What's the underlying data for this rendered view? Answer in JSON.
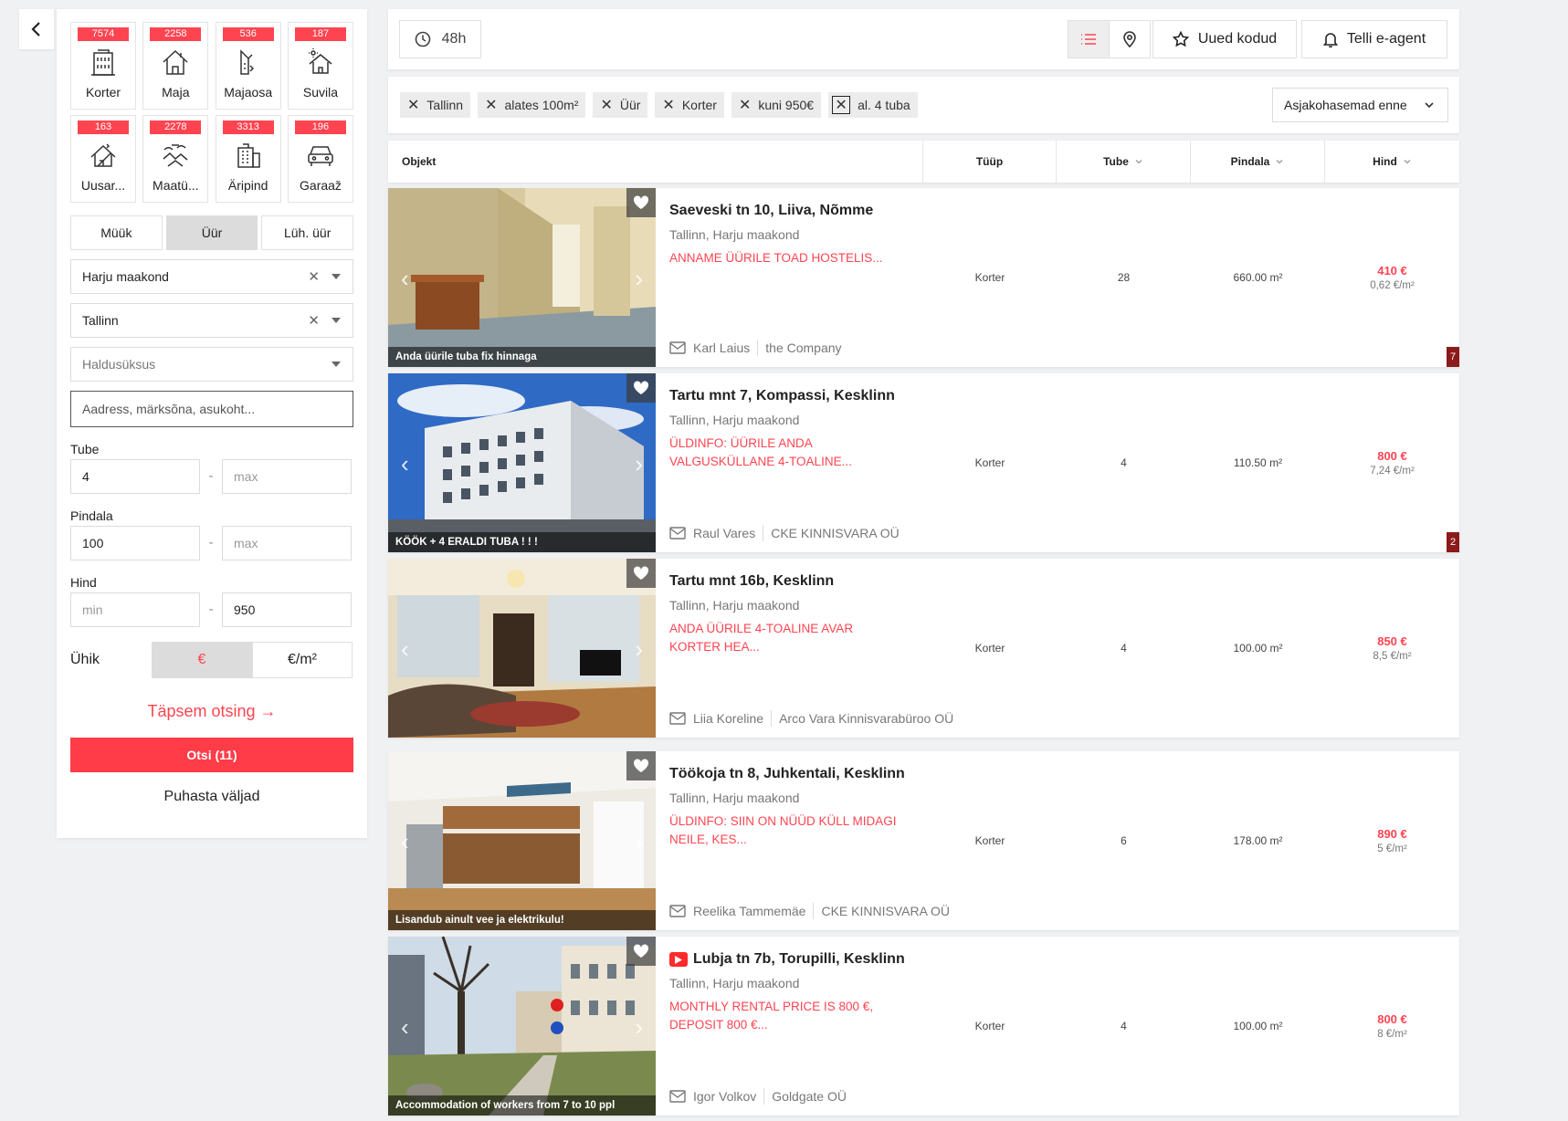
{
  "categories": [
    {
      "count": "7574",
      "label": "Korter",
      "icon": "apartment-building-icon",
      "active": true
    },
    {
      "count": "2258",
      "label": "Maja",
      "icon": "house-icon",
      "active": false
    },
    {
      "count": "536",
      "label": "Majaosa",
      "icon": "house-part-icon",
      "active": false
    },
    {
      "count": "187",
      "label": "Suvila",
      "icon": "summer-house-icon",
      "active": false
    },
    {
      "count": "163",
      "label": "Uusar...",
      "icon": "new-development-icon",
      "active": false
    },
    {
      "count": "2278",
      "label": "Maatü...",
      "icon": "land-plot-icon",
      "active": false
    },
    {
      "count": "3313",
      "label": "Äripind",
      "icon": "commercial-building-icon",
      "active": false
    },
    {
      "count": "196",
      "label": "Garaaž",
      "icon": "car-garage-icon",
      "active": false
    }
  ],
  "deal_types": {
    "sale": "Müük",
    "rent": "Üür",
    "short_rent": "Lüh. üür",
    "active": "rent"
  },
  "filters": {
    "county": "Harju maakond",
    "city": "Tallinn",
    "district_placeholder": "Haldusüksus",
    "address_placeholder": "Aadress, märksõna, asukoht...",
    "rooms_label": "Tube",
    "rooms_min": "4",
    "rooms_max_placeholder": "max",
    "area_label": "Pindala",
    "area_min": "100",
    "area_max_placeholder": "max",
    "price_label": "Hind",
    "price_min_placeholder": "min",
    "price_max": "950",
    "unit_label": "Ühik",
    "unit_eur": "€",
    "unit_eur_m2": "€/m²",
    "advanced": "Täpsem otsing →",
    "search_button": "Otsi (11)",
    "clear": "Puhasta väljad"
  },
  "topbar": {
    "recent": "48h",
    "new_homes": "Uued kodud",
    "e_agent": "Telli e-agent"
  },
  "chips": [
    "Tallinn",
    "alates 100m²",
    "Üür",
    "Korter",
    "kuni 950€",
    "al. 4 tuba"
  ],
  "sort": "Asjakohasemad enne",
  "table_headers": {
    "object": "Objekt",
    "type": "Tüüp",
    "rooms": "Tube",
    "area": "Pindala",
    "price": "Hind"
  },
  "listings": [
    {
      "title": "Saeveski tn 10, Liiva, Nõmme",
      "location": "Tallinn, Harju maakond",
      "description": "ANNAME ÜÜRILE TOAD HOSTELIS...",
      "caption": "Anda üürile tuba fix hinnaga",
      "agent": "Karl Laius",
      "company": "the Company",
      "type": "Korter",
      "rooms": "28",
      "area": "660.00 m²",
      "price": "410 €",
      "price_per_m2": "0,62 €/m²",
      "count": "7",
      "video": false
    },
    {
      "title": "Tartu mnt 7, Kompassi, Kesklinn",
      "location": "Tallinn, Harju maakond",
      "description": "ÜLDINFO: ÜÜRILE ANDA VALGUSKÜLLANE 4-TOALINE...",
      "caption": "KÖÖK + 4 ERALDI TUBA ! ! !",
      "agent": "Raul Vares",
      "company": "CKE KINNISVARA OÜ",
      "type": "Korter",
      "rooms": "4",
      "area": "110.50 m²",
      "price": "800 €",
      "price_per_m2": "7,24 €/m²",
      "count": "2",
      "video": false
    },
    {
      "title": "Tartu mnt 16b, Kesklinn",
      "location": "Tallinn, Harju maakond",
      "description": "ANDA ÜÜRILE 4-TOALINE AVAR KORTER HEA...",
      "caption": "",
      "agent": "Liia Koreline",
      "company": "Arco Vara Kinnisvarabüroo OÜ",
      "type": "Korter",
      "rooms": "4",
      "area": "100.00 m²",
      "price": "850 €",
      "price_per_m2": "8,5 €/m²",
      "count": "",
      "video": false
    },
    {
      "title": "Töökoja tn 8, Juhkentali, Kesklinn",
      "location": "Tallinn, Harju maakond",
      "description": "ÜLDINFO: SIIN ON NÜÜD KÜLL MIDAGI NEILE, KES...",
      "caption": "Lisandub ainult vee ja elektrikulu!",
      "agent": "Reelika Tammemäe",
      "company": "CKE KINNISVARA OÜ",
      "type": "Korter",
      "rooms": "6",
      "area": "178.00 m²",
      "price": "890 €",
      "price_per_m2": "5 €/m²",
      "count": "",
      "video": false
    },
    {
      "title": "Lubja tn 7b, Torupilli, Kesklinn",
      "location": "Tallinn, Harju maakond",
      "description": "MONTHLY RENTAL PRICE IS 800 €, DEPOSIT 800 €...",
      "caption": "Accommodation of workers from 7 to 10 ppl",
      "agent": "Igor Volkov",
      "company": "Goldgate OÜ",
      "type": "Korter",
      "rooms": "4",
      "area": "100.00 m²",
      "price": "800 €",
      "price_per_m2": "8 €/m²",
      "count": "",
      "video": true
    }
  ]
}
